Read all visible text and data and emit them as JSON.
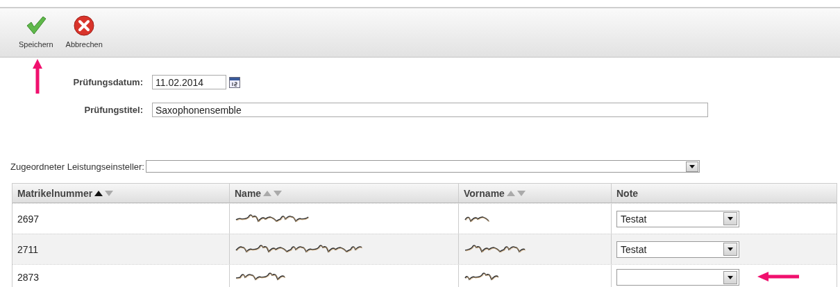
{
  "toolbar": {
    "buttons": [
      {
        "kind": "save",
        "label": "Speichern",
        "annotated": true
      },
      {
        "kind": "cancel",
        "label": "Abbrechen",
        "annotated": false
      }
    ]
  },
  "form": {
    "fields": [
      {
        "kind": "date",
        "label": "Prüfungsdatum:",
        "value": "11.02.2014"
      },
      {
        "kind": "text",
        "label": "Prüfungstitel:",
        "value": "Saxophonensemble"
      }
    ]
  },
  "assignee": {
    "label": "Zugeordneter Leistungseinsteller:"
  },
  "table": {
    "columns": [
      {
        "label": "Matrikelnummer",
        "sortable": true,
        "sorted_ascending": true
      },
      {
        "label": "Name",
        "sortable": true,
        "sorted_ascending": false
      },
      {
        "label": "Vorname",
        "sortable": true,
        "sorted_ascending": false
      },
      {
        "label": "Note",
        "sortable": false
      }
    ],
    "rows": [
      {
        "matrikelnummer": "2697",
        "name_redacted": true,
        "vorname_redacted": true,
        "note": "Testat",
        "annotated": false
      },
      {
        "matrikelnummer": "2711",
        "name_redacted": true,
        "vorname_redacted": true,
        "note": "Testat",
        "annotated": false
      },
      {
        "matrikelnummer": "2873",
        "name_redacted": true,
        "vorname_redacted": true,
        "annotated": true
      }
    ]
  }
}
